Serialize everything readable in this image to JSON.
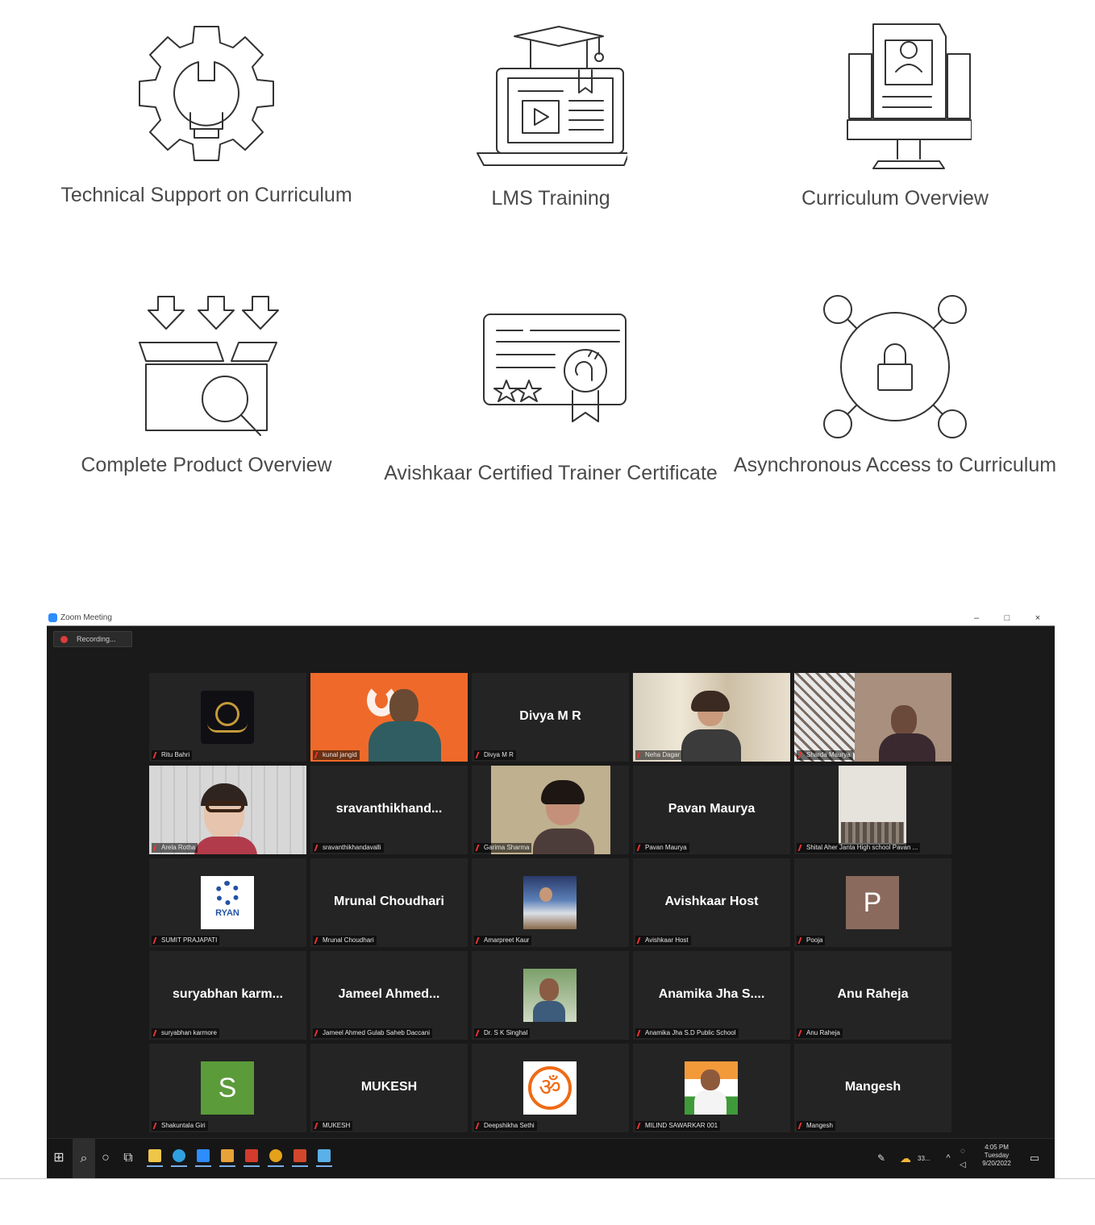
{
  "features": [
    {
      "label": "Technical Support on Curriculum",
      "icon": "gear-bulb-icon"
    },
    {
      "label": "LMS Training",
      "icon": "laptop-graduation-cap-icon"
    },
    {
      "label": "Curriculum Overview",
      "icon": "monitor-profile-document-icon"
    },
    {
      "label": "Complete Product Overview",
      "icon": "box-magnifier-icon"
    },
    {
      "label": "Avishkaar Certified Trainer Certificate",
      "icon": "certificate-badge-icon"
    },
    {
      "label": "Asynchronous Access to Curriculum",
      "icon": "network-lock-icon"
    }
  ],
  "zoom": {
    "window_title": "Zoom Meeting",
    "recording_label": "Recording...",
    "controls": {
      "minimize": "–",
      "maximize": "□",
      "close": "×"
    },
    "participants": [
      {
        "tag": "Ritu Bahri",
        "display": "",
        "kind": "logo-dark"
      },
      {
        "tag": "kunal jangid",
        "display": "",
        "kind": "video-orange"
      },
      {
        "tag": "Divya M R",
        "display": "Divya M R",
        "kind": "name"
      },
      {
        "tag": "Neha Dagar",
        "display": "",
        "kind": "video-curtain"
      },
      {
        "tag": "Sharda Maurya",
        "display": "",
        "kind": "video-room"
      },
      {
        "tag": "Arela Rotha",
        "display": "",
        "kind": "video-wall"
      },
      {
        "tag": "sravanthikhandavalli",
        "display": "sravanthikhand...",
        "kind": "name"
      },
      {
        "tag": "Garima Sharma",
        "display": "",
        "kind": "video-person"
      },
      {
        "tag": "Pavan Maurya",
        "display": "Pavan Maurya",
        "kind": "name"
      },
      {
        "tag": "Shital Aher Janta High school Pavan ...",
        "display": "",
        "kind": "video-class"
      },
      {
        "tag": "SUMIT PRAJAPATI",
        "display": "",
        "kind": "logo-ryan"
      },
      {
        "tag": "Mrunal Choudhari",
        "display": "Mrunal Choudhari",
        "kind": "name"
      },
      {
        "tag": "Amarpreet Kaur",
        "display": "",
        "kind": "photo-desk"
      },
      {
        "tag": "Avishkaar Host",
        "display": "Avishkaar Host",
        "kind": "name"
      },
      {
        "tag": "Pooja",
        "display": "",
        "kind": "avatar-p"
      },
      {
        "tag": "suryabhan karmore",
        "display": "suryabhan  karm...",
        "kind": "name"
      },
      {
        "tag": "Jameel Ahmed  Gulab Saheb Daccani",
        "display": "Jameel  Ahmed...",
        "kind": "name"
      },
      {
        "tag": "Dr. S K Singhal",
        "display": "",
        "kind": "photo-man"
      },
      {
        "tag": "Anamika Jha S.D Public School",
        "display": "Anamika  Jha  S....",
        "kind": "name"
      },
      {
        "tag": "Anu Raheja",
        "display": "Anu Raheja",
        "kind": "name"
      },
      {
        "tag": "Shakuntala Giri",
        "display": "",
        "kind": "avatar-s"
      },
      {
        "tag": "MUKESH",
        "display": "MUKESH",
        "kind": "name"
      },
      {
        "tag": "Deepshikha Sethi",
        "display": "",
        "kind": "logo-om"
      },
      {
        "tag": "MILIND SAWARKAR 001",
        "display": "",
        "kind": "photo-flag"
      },
      {
        "tag": "Mangesh",
        "display": "Mangesh",
        "kind": "name"
      }
    ],
    "avatar_letters": {
      "p": "P",
      "s": "S"
    },
    "ryan_text": "RYAN",
    "taskbar": {
      "time": "4:05 PM",
      "day": "Tuesday",
      "date": "9/20/2022",
      "weather": "33..."
    }
  }
}
